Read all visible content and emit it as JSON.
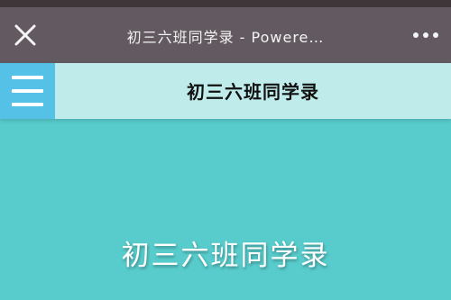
{
  "browser": {
    "title": "初三六班同学录 - Powere…",
    "close_icon": "close-icon",
    "more_icon": "more-dots-icon"
  },
  "header": {
    "title": "初三六班同学录",
    "menu_icon": "hamburger-menu-icon"
  },
  "hero": {
    "title": "初三六班同学录"
  },
  "colors": {
    "status_strip": "#3e3638",
    "titlebar": "#625a60",
    "header_bg": "#bfeceb",
    "menu_button": "#56c1e6",
    "page_bg": "#58cccc"
  }
}
